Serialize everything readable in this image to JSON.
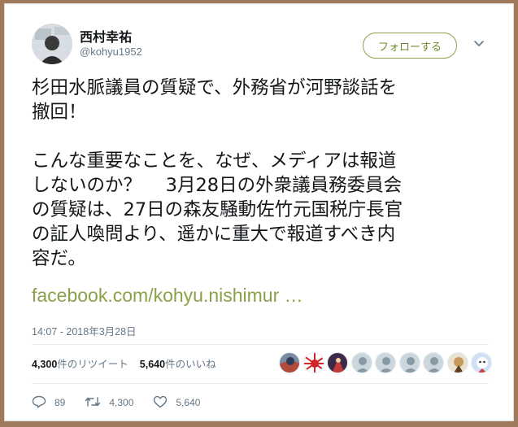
{
  "user": {
    "display_name": "西村幸祐",
    "screen_name": "@kohyu1952"
  },
  "follow_button": {
    "label": "フォローする"
  },
  "tweet": {
    "text": "杉田水脈議員の質疑で、外務省が河野談話を\n撤回！\n\nこんな重要なことを、なぜ、メディアは報道\nしないのか？　 3月28日の外衆議員務委員会\nの質疑は、27日の森友騒動佐竹元国税庁長官\nの証人喚問より、遥かに重大で報道すべき内\n容だ。",
    "link": "facebook.com/kohyu.nishimur …",
    "timestamp": "14:07 - 2018年3月28日"
  },
  "stats": {
    "retweets_count": "4,300",
    "retweets_label": "件のリツイート",
    "likes_count": "5,640",
    "likes_label": "件のいいね"
  },
  "actions": {
    "reply_count": "89",
    "retweet_count": "4,300",
    "like_count": "5,640"
  },
  "colors": {
    "accent": "#8aa14a",
    "secondary_text": "#657786",
    "border": "#e6ecf0",
    "frame": "#a07a5b"
  },
  "icons": [
    "chevron-down-icon",
    "reply-icon",
    "retweet-icon",
    "heart-icon"
  ]
}
